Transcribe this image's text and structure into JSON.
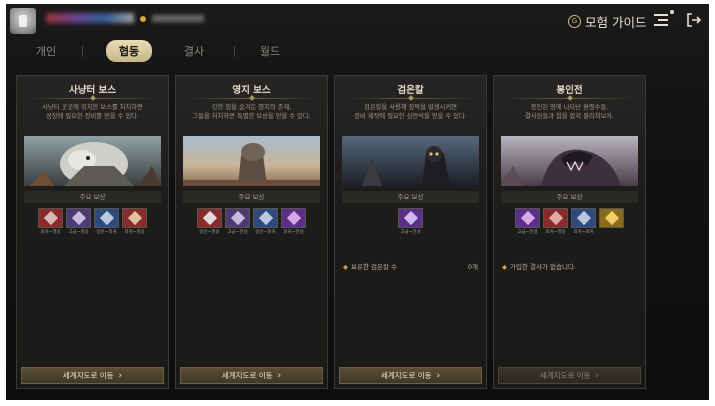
{
  "header": {
    "guide_icon": "guide-icon",
    "guide_label": "모험 가이드"
  },
  "tabs": [
    {
      "label": "개인"
    },
    {
      "label": "협동"
    },
    {
      "label": "결사"
    },
    {
      "label": "월드"
    }
  ],
  "active_tab": "협동",
  "cards": [
    {
      "title": "사냥터 보스",
      "desc_line1": "사냥터 곳곳에 위치한 보스를 처치하면",
      "desc_line2": "성장에 필요한 장비를 얻을 수 있다.",
      "reward_label": "주요 보상",
      "rewards": [
        {
          "cap": "희귀~영웅",
          "color": "#8a2b2b"
        },
        {
          "cap": "고급~영웅",
          "color": "#4b3b72"
        },
        {
          "cap": "일반~희귀",
          "color": "#2f4a7a"
        },
        {
          "cap": "희귀~영웅",
          "color": "#8a2b2b"
        }
      ],
      "button_label": "세계지도로 이동"
    },
    {
      "title": "영지 보스",
      "desc_line1": "강한 힘을 숨겨둔 영지의 존재,",
      "desc_line2": "그들을 처치하면 특별한 보상을 얻을 수 있다.",
      "reward_label": "주요 보상",
      "rewards": [
        {
          "cap": "일반~영웅",
          "color": "#8a2b2b"
        },
        {
          "cap": "고급~전설",
          "color": "#4b3b72"
        },
        {
          "cap": "일반~희귀",
          "color": "#2f4a7a"
        },
        {
          "cap": "희귀~전설",
          "color": "#5a2f88"
        }
      ],
      "button_label": "세계지도로 이동"
    },
    {
      "title": "검은칼",
      "desc_line1": "검은칼을 사용해 장막을 발생시키면",
      "desc_line2": "장비 제작에 필요한 심연석을 얻을 수 있다.",
      "reward_label": "주요 보상",
      "rewards": [
        {
          "cap": "고급~전설",
          "color": "#5a2f88"
        }
      ],
      "info_label": "보유한 검은칼 수",
      "info_value": "0개",
      "button_label": "세계지도로 이동"
    },
    {
      "title": "봉인전",
      "desc_line1": "봉인된 땅에 나타난 환령수들.",
      "desc_line2": "결사원들과 힘을 합쳐 물리쳐보자.",
      "reward_label": "주요 보상",
      "rewards": [
        {
          "cap": "고급~전설",
          "color": "#5a2f88"
        },
        {
          "cap": "희귀~영웅",
          "color": "#8a2b2b"
        },
        {
          "cap": "희귀~희귀",
          "color": "#2f4a7a"
        },
        {
          "cap": "",
          "color": "#8a6a1b"
        }
      ],
      "info_label": "가입한 결사가 없습니다.",
      "button_label": "세계지도로 이동",
      "button_disabled": true
    }
  ]
}
